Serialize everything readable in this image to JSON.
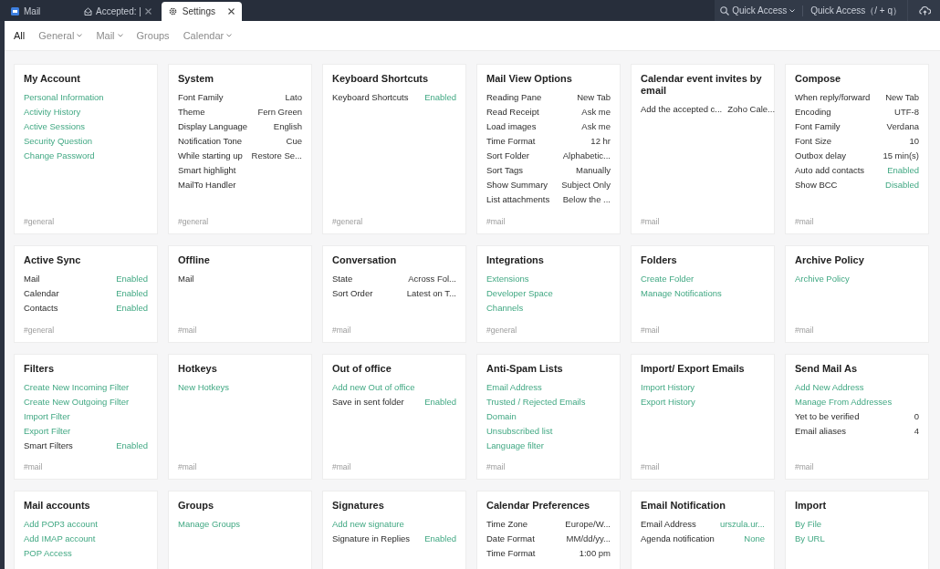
{
  "topbar": {
    "tabs": [
      {
        "label": "Mail",
        "kind": "app",
        "selected": false,
        "closable": false
      },
      {
        "label": "Accepted: |",
        "kind": "message",
        "selected": false,
        "closable": true
      },
      {
        "label": "Settings",
        "kind": "settings",
        "selected": true,
        "closable": true
      }
    ],
    "quick_access": {
      "label": "Quick Access",
      "shortcut_label": "Quick Access（/ + q）"
    }
  },
  "nav": [
    {
      "label": "All",
      "selected": true,
      "dropdown": false
    },
    {
      "label": "General",
      "selected": false,
      "dropdown": true
    },
    {
      "label": "Mail",
      "selected": false,
      "dropdown": true
    },
    {
      "label": "Groups",
      "selected": false,
      "dropdown": false
    },
    {
      "label": "Calendar",
      "selected": false,
      "dropdown": true
    }
  ],
  "cards": [
    {
      "title": "My Account",
      "tag": "#general",
      "items": [
        {
          "kind": "link",
          "label": "Personal Information"
        },
        {
          "kind": "link",
          "label": "Activity History"
        },
        {
          "kind": "link",
          "label": "Active Sessions"
        },
        {
          "kind": "link",
          "label": "Security Question"
        },
        {
          "kind": "link",
          "label": "Change Password"
        }
      ]
    },
    {
      "title": "System",
      "tag": "#general",
      "items": [
        {
          "kind": "setting",
          "label": "Font Family",
          "value": "Lato",
          "accent": false
        },
        {
          "kind": "setting",
          "label": "Theme",
          "value": "Fern Green",
          "accent": false
        },
        {
          "kind": "setting",
          "label": "Display Language",
          "value": "English",
          "accent": false
        },
        {
          "kind": "setting",
          "label": "Notification Tone",
          "value": "Cue",
          "accent": false
        },
        {
          "kind": "setting",
          "label": "While starting up",
          "value": "Restore Se...",
          "accent": false
        },
        {
          "kind": "setting",
          "label": "Smart highlight"
        },
        {
          "kind": "setting",
          "label": "MailTo Handler"
        }
      ]
    },
    {
      "title": "Keyboard Shortcuts",
      "tag": "#general",
      "items": [
        {
          "kind": "setting",
          "label": "Keyboard Shortcuts",
          "value": "Enabled",
          "accent": true
        }
      ]
    },
    {
      "title": "Mail View Options",
      "tag": "#mail",
      "items": [
        {
          "kind": "setting",
          "label": "Reading Pane",
          "value": "New Tab",
          "accent": false
        },
        {
          "kind": "setting",
          "label": "Read Receipt",
          "value": "Ask me",
          "accent": false
        },
        {
          "kind": "setting",
          "label": "Load images",
          "value": "Ask me",
          "accent": false
        },
        {
          "kind": "setting",
          "label": "Time Format",
          "value": "12 hr",
          "accent": false
        },
        {
          "kind": "setting",
          "label": "Sort Folder",
          "value": "Alphabetic...",
          "accent": false
        },
        {
          "kind": "setting",
          "label": "Sort Tags",
          "value": "Manually",
          "accent": false
        },
        {
          "kind": "setting",
          "label": "Show Summary",
          "value": "Subject Only",
          "accent": false
        },
        {
          "kind": "setting",
          "label": "List attachments",
          "value": "Below the ...",
          "accent": false
        }
      ]
    },
    {
      "title": "Calendar event invites by email",
      "tag": "#mail",
      "items": [
        {
          "kind": "setting",
          "label": "Add the accepted c...",
          "value": "Zoho Cale...",
          "accent": false
        }
      ]
    },
    {
      "title": "Compose",
      "tag": "#mail",
      "items": [
        {
          "kind": "setting",
          "label": "When reply/forward",
          "value": "New Tab",
          "accent": false
        },
        {
          "kind": "setting",
          "label": "Encoding",
          "value": "UTF-8",
          "accent": false
        },
        {
          "kind": "setting",
          "label": "Font Family",
          "value": "Verdana",
          "accent": false
        },
        {
          "kind": "setting",
          "label": "Font Size",
          "value": "10",
          "accent": false
        },
        {
          "kind": "setting",
          "label": "Outbox delay",
          "value": "15 min(s)",
          "accent": false
        },
        {
          "kind": "setting",
          "label": "Auto add contacts",
          "value": "Enabled",
          "accent": true
        },
        {
          "kind": "setting",
          "label": "Show BCC",
          "value": "Disabled",
          "accent": true
        }
      ]
    },
    {
      "title": "Active Sync",
      "tag": "#general",
      "items": [
        {
          "kind": "setting",
          "label": "Mail",
          "value": "Enabled",
          "accent": true
        },
        {
          "kind": "setting",
          "label": "Calendar",
          "value": "Enabled",
          "accent": true
        },
        {
          "kind": "setting",
          "label": "Contacts",
          "value": "Enabled",
          "accent": true
        }
      ]
    },
    {
      "title": "Offline",
      "tag": "#mail",
      "items": [
        {
          "kind": "setting",
          "label": "Mail"
        }
      ]
    },
    {
      "title": "Conversation",
      "tag": "#mail",
      "items": [
        {
          "kind": "setting",
          "label": "State",
          "value": "Across Fol...",
          "accent": false
        },
        {
          "kind": "setting",
          "label": "Sort Order",
          "value": "Latest on T...",
          "accent": false
        }
      ]
    },
    {
      "title": "Integrations",
      "tag": "#general",
      "items": [
        {
          "kind": "link",
          "label": "Extensions"
        },
        {
          "kind": "link",
          "label": "Developer Space"
        },
        {
          "kind": "link",
          "label": "Channels"
        }
      ]
    },
    {
      "title": "Folders",
      "tag": "#mail",
      "items": [
        {
          "kind": "link",
          "label": "Create Folder"
        },
        {
          "kind": "link",
          "label": "Manage Notifications"
        }
      ]
    },
    {
      "title": "Archive Policy",
      "tag": "#mail",
      "items": [
        {
          "kind": "link",
          "label": "Archive Policy"
        }
      ]
    },
    {
      "title": "Filters",
      "tag": "#mail",
      "items": [
        {
          "kind": "link",
          "label": "Create New Incoming Filter"
        },
        {
          "kind": "link",
          "label": "Create New Outgoing Filter"
        },
        {
          "kind": "link",
          "label": "Import Filter"
        },
        {
          "kind": "link",
          "label": "Export Filter"
        },
        {
          "kind": "setting",
          "label": "Smart Filters",
          "value": "Enabled",
          "accent": true
        }
      ]
    },
    {
      "title": "Hotkeys",
      "tag": "#mail",
      "items": [
        {
          "kind": "link",
          "label": "New Hotkeys"
        }
      ]
    },
    {
      "title": "Out of office",
      "tag": "#mail",
      "items": [
        {
          "kind": "link",
          "label": "Add new Out of office"
        },
        {
          "kind": "setting",
          "label": "Save in sent folder",
          "value": "Enabled",
          "accent": true
        }
      ]
    },
    {
      "title": "Anti-Spam Lists",
      "tag": "#mail",
      "items": [
        {
          "kind": "link",
          "label": "Email Address"
        },
        {
          "kind": "link",
          "label": "Trusted / Rejected Emails"
        },
        {
          "kind": "link",
          "label": "Domain"
        },
        {
          "kind": "link",
          "label": "Unsubscribed list"
        },
        {
          "kind": "link",
          "label": "Language filter"
        }
      ]
    },
    {
      "title": "Import/ Export Emails",
      "tag": "#mail",
      "items": [
        {
          "kind": "link",
          "label": "Import History"
        },
        {
          "kind": "link",
          "label": "Export History"
        }
      ]
    },
    {
      "title": "Send Mail As",
      "tag": "#mail",
      "items": [
        {
          "kind": "link",
          "label": "Add New Address"
        },
        {
          "kind": "link",
          "label": "Manage From Addresses"
        },
        {
          "kind": "setting",
          "label": "Yet to be verified",
          "value": "0",
          "accent": false
        },
        {
          "kind": "setting",
          "label": "Email aliases",
          "value": "4",
          "accent": false
        }
      ]
    },
    {
      "title": "Mail accounts",
      "items": [
        {
          "kind": "link",
          "label": "Add POP3 account"
        },
        {
          "kind": "link",
          "label": "Add IMAP account"
        },
        {
          "kind": "link",
          "label": "POP Access"
        }
      ]
    },
    {
      "title": "Groups",
      "items": [
        {
          "kind": "link",
          "label": "Manage Groups"
        }
      ]
    },
    {
      "title": "Signatures",
      "items": [
        {
          "kind": "link",
          "label": "Add new signature"
        },
        {
          "kind": "setting",
          "label": "Signature in Replies",
          "value": "Enabled",
          "accent": true
        }
      ]
    },
    {
      "title": "Calendar Preferences",
      "items": [
        {
          "kind": "setting",
          "label": "Time Zone",
          "value": "Europe/W...",
          "accent": false
        },
        {
          "kind": "setting",
          "label": "Date Format",
          "value": "MM/dd/yy...",
          "accent": false
        },
        {
          "kind": "setting",
          "label": "Time Format",
          "value": "1:00 pm",
          "accent": false
        }
      ]
    },
    {
      "title": "Email Notification",
      "items": [
        {
          "kind": "setting",
          "label": "Email Address",
          "value": "urszula.ur...",
          "accent": true
        },
        {
          "kind": "setting",
          "label": "Agenda notification",
          "value": "None",
          "accent": true
        }
      ]
    },
    {
      "title": "Import",
      "items": [
        {
          "kind": "link",
          "label": "By File"
        },
        {
          "kind": "link",
          "label": "By URL"
        }
      ]
    }
  ]
}
